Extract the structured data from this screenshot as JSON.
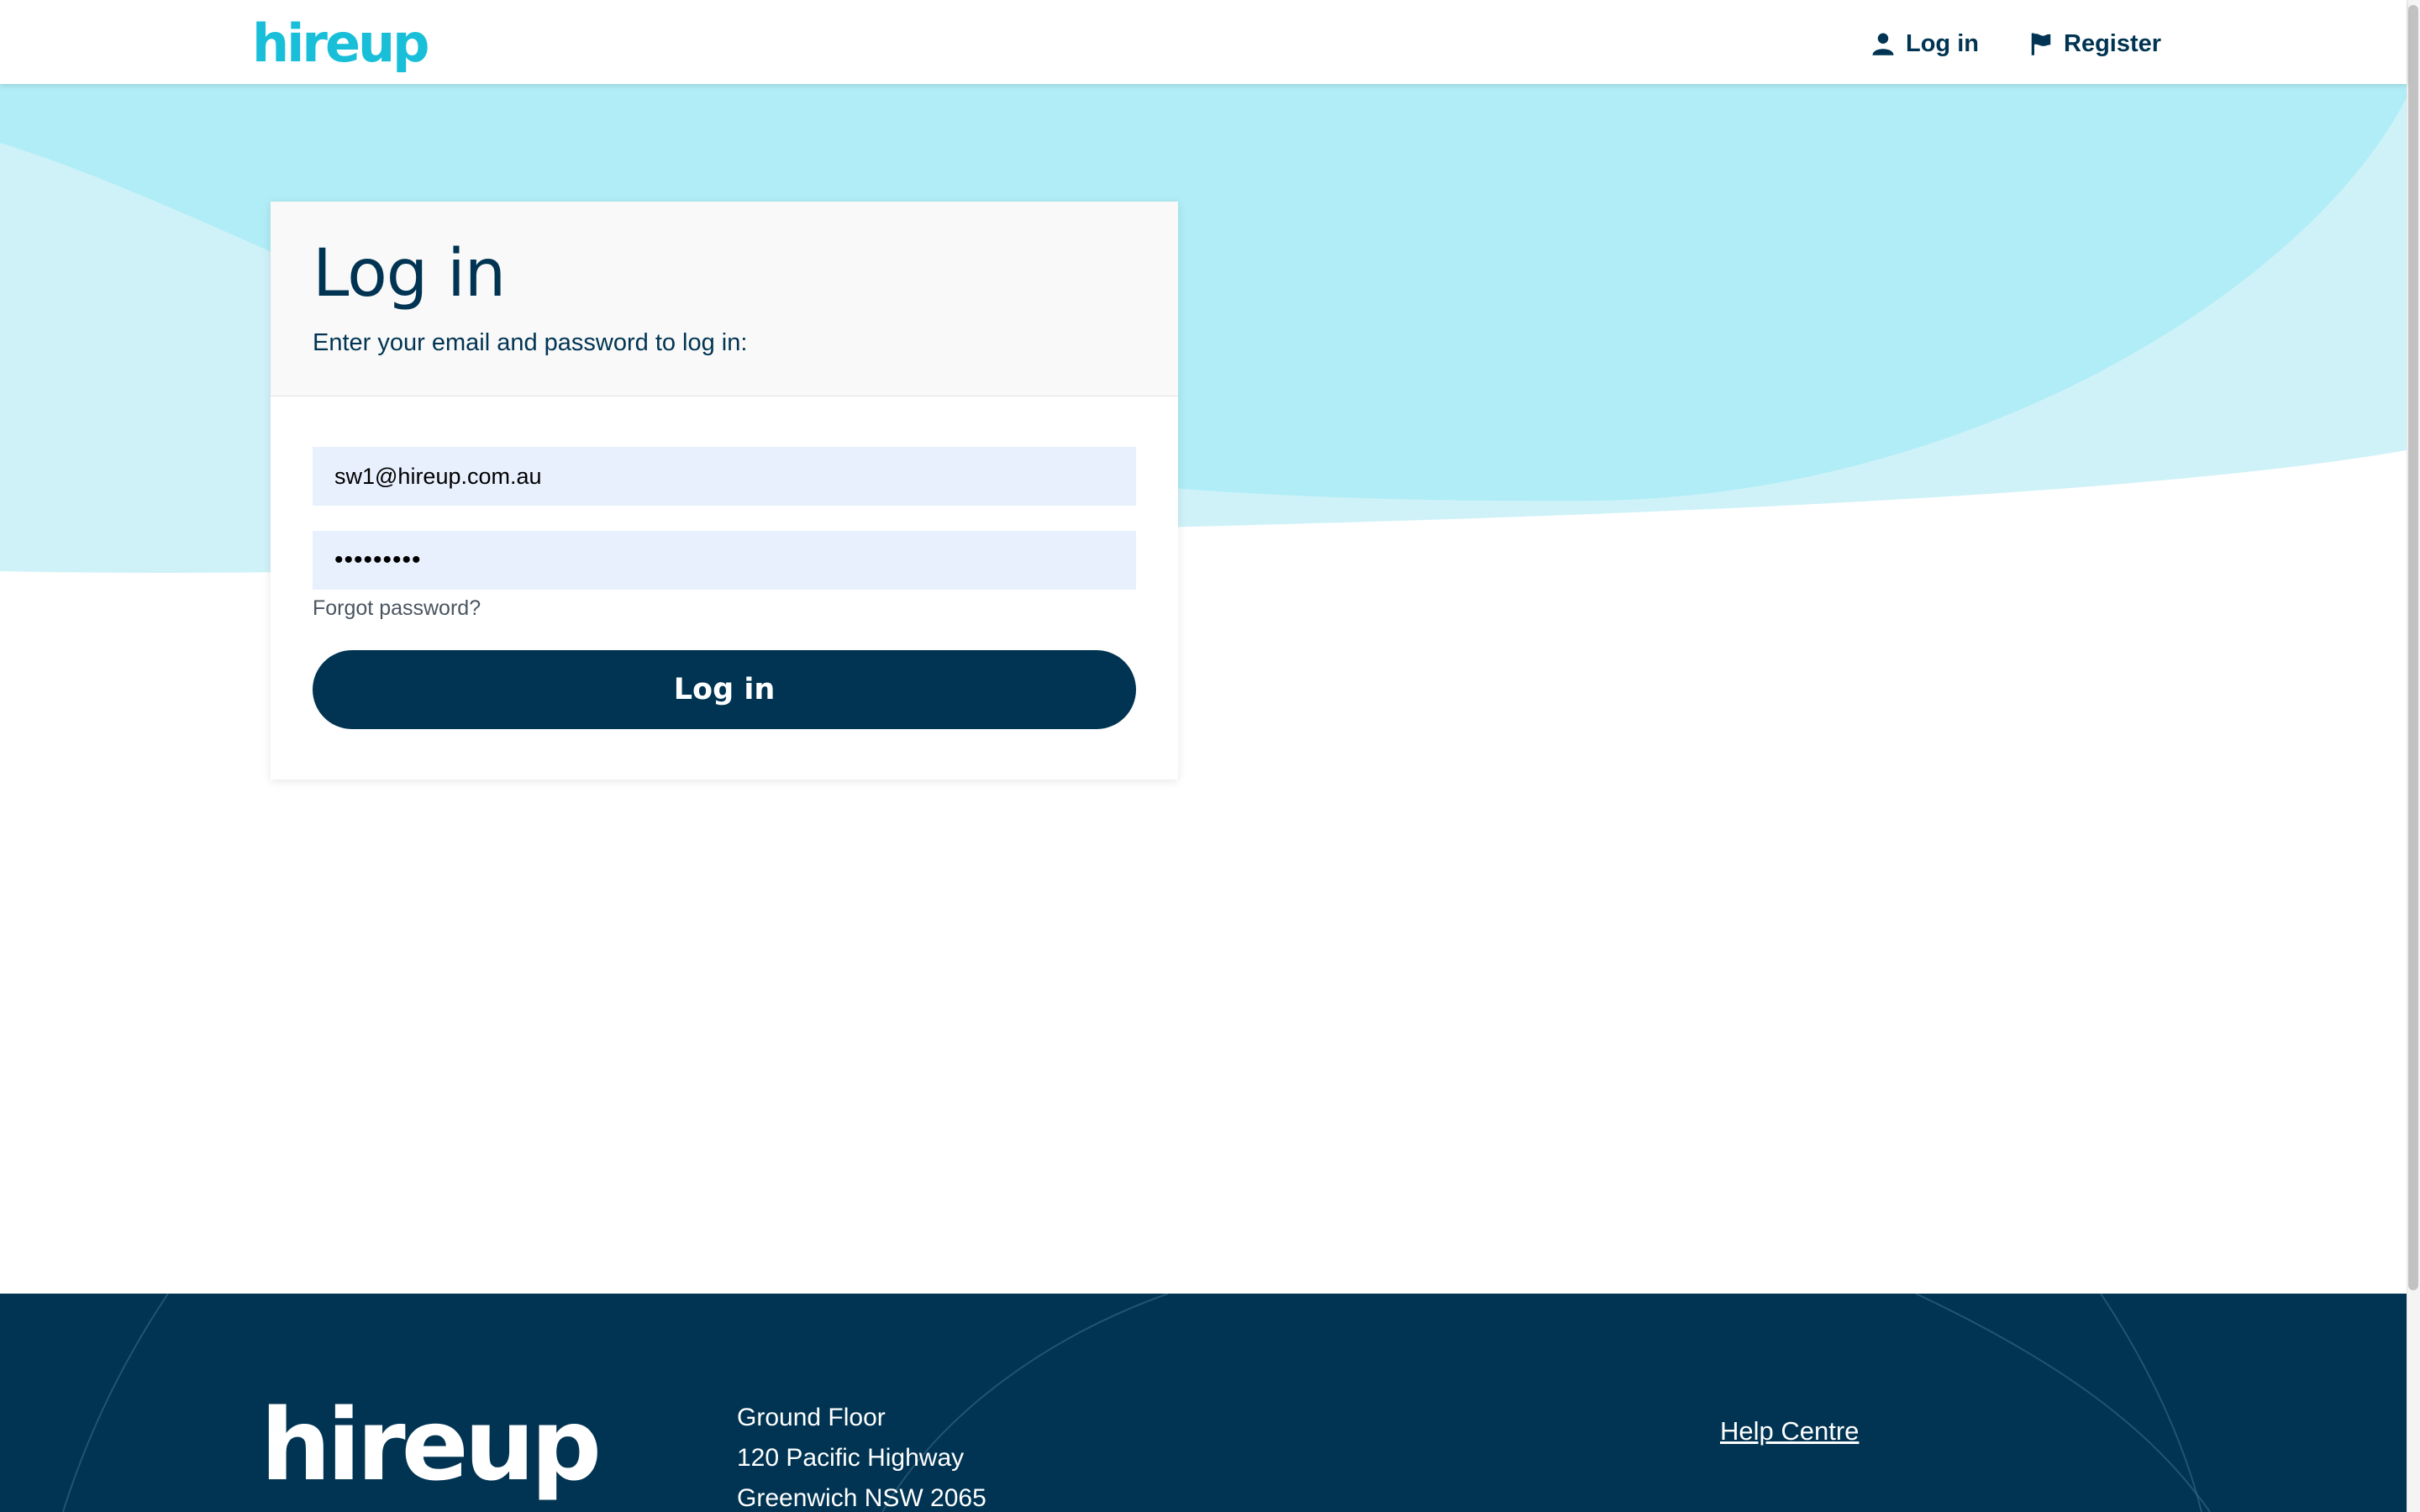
{
  "header": {
    "logo": "hireup",
    "nav": {
      "login_label": "Log in",
      "register_label": "Register"
    }
  },
  "login_card": {
    "title": "Log in",
    "subtitle": "Enter your email and password to log in:",
    "email_value": "sw1@hireup.com.au",
    "password_value": "•••••••••",
    "forgot_label": "Forgot password?",
    "submit_label": "Log in"
  },
  "footer": {
    "logo": "hireup",
    "address": {
      "line1": "Ground Floor",
      "line2": "120 Pacific Highway",
      "line3": "Greenwich NSW 2065"
    },
    "help_label": "Help Centre"
  },
  "colors": {
    "brand_cyan": "#19bfd8",
    "navy": "#003452",
    "wave_light": "#cff2f9",
    "wave_mid": "#b0edf6",
    "autofill_blue": "#e8f0fe"
  }
}
